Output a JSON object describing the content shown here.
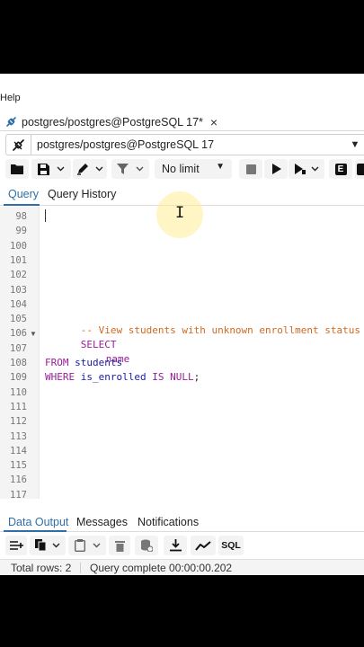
{
  "menubar": {
    "help_label": "Help"
  },
  "tab": {
    "title": "postgres/postgres@PostgreSQL 17*"
  },
  "connection": {
    "label": "postgres/postgres@PostgreSQL 17"
  },
  "toolbar": {
    "limit_label": "No limit",
    "explain_label": "E"
  },
  "query_tabs": {
    "query": "Query",
    "history": "Query History"
  },
  "editor": {
    "line_numbers": [
      "98",
      "99",
      "100",
      "101",
      "102",
      "103",
      "104",
      "105",
      "106",
      "107",
      "108",
      "109",
      "110",
      "111",
      "112",
      "113",
      "114",
      "115",
      "116",
      "117"
    ],
    "comment": "-- View students with unknown enrollment status",
    "select_kw": "SELECT",
    "col_name": "name",
    "from_kw": "FROM",
    "table_name": "students",
    "where_kw": "WHERE",
    "where_col": "is_enrolled",
    "is_null": "IS NULL",
    "terminator": ";"
  },
  "output_tabs": {
    "data_output": "Data Output",
    "messages": "Messages",
    "notifications": "Notifications"
  },
  "output_toolbar": {
    "sql_label": "SQL"
  },
  "status": {
    "total_rows": "Total rows: 2",
    "query_complete": "Query complete 00:00:00.202"
  },
  "colors": {
    "keyword": "#9b1b9b",
    "comment": "#d2691e",
    "identifier": "#1a1aa6",
    "accent": "#2f6fa7"
  },
  "icons": [
    "connection-icon",
    "folder-icon",
    "save-icon",
    "chevron-down-icon",
    "edit-pen-icon",
    "filter-icon",
    "stop-icon",
    "play-icon",
    "explain-icon",
    "trash-icon",
    "copy-icon",
    "paste-icon",
    "download-icon",
    "graph-icon",
    "database-icon",
    "close-icon",
    "text-cursor-icon"
  ]
}
